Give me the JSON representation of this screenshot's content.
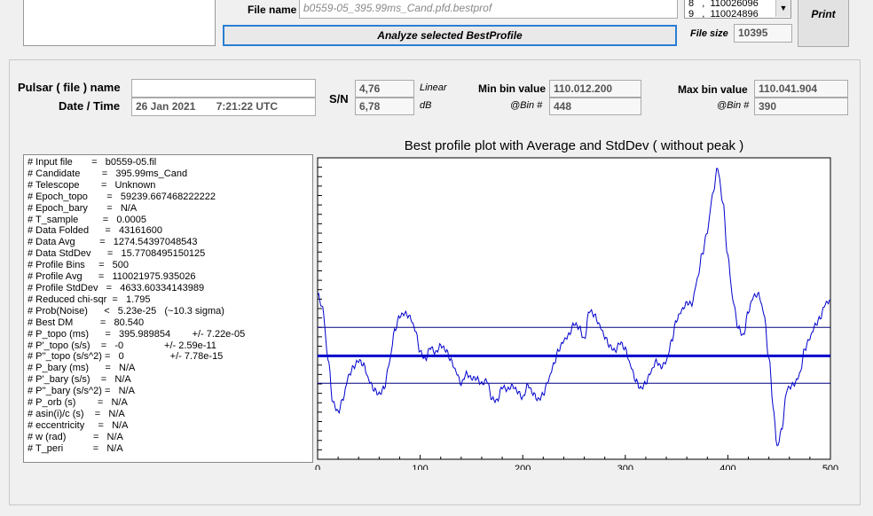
{
  "top": {
    "file_name_label": "File name",
    "file_name_value": "b0559-05_395.99ms_Cand.pfd.bestprof",
    "list_lines": [
      "8   ,  110026096",
      "9   ,  110024896"
    ],
    "analyze_button": "Analyze selected BestProfile",
    "file_size_label": "File size",
    "file_size_value": "10395",
    "print_button": "Print"
  },
  "header": {
    "pulsar_label": "Pulsar ( file ) name",
    "pulsar_value": "",
    "datetime_label": "Date / Time",
    "date_value": "26 Jan 2021",
    "time_value": "7:21:22  UTC",
    "sn_label": "S/N",
    "sn_linear_value": "4,76",
    "sn_linear_label": "Linear",
    "sn_db_value": "6,78",
    "sn_db_label": "dB",
    "min_bin_label": "Min bin value",
    "min_bin_value": "110.012.200",
    "min_at_label": "@Bin #",
    "min_at_value": "448",
    "max_bin_label": "Max bin value",
    "max_bin_value": "110.041.904",
    "max_at_label": "@Bin #",
    "max_at_value": "390"
  },
  "info_lines": [
    "# Input file       =   b0559-05.fil",
    "# Candidate        =   395.99ms_Cand",
    "# Telescope        =   Unknown",
    "# Epoch_topo       =   59239.667468222222",
    "# Epoch_bary       =   N/A",
    "# T_sample         =   0.0005",
    "# Data Folded      =   43161600",
    "# Data Avg         =   1274.54397048543",
    "# Data StdDev      =   15.7708495150125",
    "# Profile Bins     =   500",
    "# Profile Avg      =   110021975.935026",
    "# Profile StdDev   =   4633.60334143989",
    "# Reduced chi-sqr  =   1.795",
    "# Prob(Noise)      <   5.23e-25   (~10.3 sigma)",
    "# Best DM          =   80.540",
    "# P_topo (ms)      =   395.989854        +/- 7.22e-05",
    "# P'_topo (s/s)    =   -0               +/- 2.59e-11",
    "# P''_topo (s/s^2) =   0                 +/- 7.78e-15",
    "# P_bary (ms)      =   N/A",
    "# P'_bary (s/s)    =   N/A",
    "# P''_bary (s/s^2) =   N/A",
    "# P_orb (s)        =   N/A",
    "# asin(i)/c (s)    =   N/A",
    "# eccentricity     =   N/A",
    "# w (rad)          =   N/A",
    "# T_peri           =   N/A"
  ],
  "chart_data": {
    "type": "line",
    "title": "Best profile plot with  Average and StdDev ( without peak )",
    "xlabel": "",
    "ylabel": "",
    "xlim": [
      0,
      500
    ],
    "ylim": [
      110011000,
      110043000
    ],
    "xticks": [
      0,
      100,
      200,
      300,
      400,
      500
    ],
    "average": 110021976,
    "std_upper": 110024996,
    "std_lower": 110019076,
    "colors": {
      "profile": "#0000cc",
      "average": "#0000cc",
      "std": "#000080"
    },
    "profile": [
      [
        0,
        110028500
      ],
      [
        5,
        110027000
      ],
      [
        10,
        110021800
      ],
      [
        15,
        110017000
      ],
      [
        20,
        110016000
      ],
      [
        25,
        110017500
      ],
      [
        30,
        110019800
      ],
      [
        35,
        110020800
      ],
      [
        40,
        110021500
      ],
      [
        45,
        110021000
      ],
      [
        50,
        110019400
      ],
      [
        55,
        110018400
      ],
      [
        60,
        110017900
      ],
      [
        65,
        110018600
      ],
      [
        70,
        110021300
      ],
      [
        75,
        110024600
      ],
      [
        80,
        110026200
      ],
      [
        85,
        110026500
      ],
      [
        90,
        110026100
      ],
      [
        95,
        110024800
      ],
      [
        100,
        110022400
      ],
      [
        105,
        110021600
      ],
      [
        110,
        110022900
      ],
      [
        115,
        110022300
      ],
      [
        120,
        110023100
      ],
      [
        125,
        110022600
      ],
      [
        130,
        110021500
      ],
      [
        135,
        110020300
      ],
      [
        140,
        110019000
      ],
      [
        145,
        110020100
      ],
      [
        150,
        110019600
      ],
      [
        155,
        110019600
      ],
      [
        160,
        110019000
      ],
      [
        165,
        110019400
      ],
      [
        170,
        110017400
      ],
      [
        175,
        110017200
      ],
      [
        180,
        110018700
      ],
      [
        185,
        110018400
      ],
      [
        190,
        110018800
      ],
      [
        195,
        110018200
      ],
      [
        200,
        110017500
      ],
      [
        205,
        110018900
      ],
      [
        210,
        110018000
      ],
      [
        215,
        110017300
      ],
      [
        220,
        110017900
      ],
      [
        225,
        110019400
      ],
      [
        230,
        110021000
      ],
      [
        235,
        110022600
      ],
      [
        240,
        110023600
      ],
      [
        245,
        110024200
      ],
      [
        250,
        110025400
      ],
      [
        255,
        110025000
      ],
      [
        260,
        110023700
      ],
      [
        265,
        110026800
      ],
      [
        270,
        110026300
      ],
      [
        275,
        110025200
      ],
      [
        280,
        110024000
      ],
      [
        285,
        110023000
      ],
      [
        290,
        110022500
      ],
      [
        295,
        110023400
      ],
      [
        300,
        110022700
      ],
      [
        305,
        110021000
      ],
      [
        310,
        110019400
      ],
      [
        315,
        110018500
      ],
      [
        320,
        110019100
      ],
      [
        325,
        110020300
      ],
      [
        330,
        110021400
      ],
      [
        335,
        110020800
      ],
      [
        340,
        110021400
      ],
      [
        345,
        110023500
      ],
      [
        350,
        110025800
      ],
      [
        355,
        110026800
      ],
      [
        360,
        110027600
      ],
      [
        365,
        110027500
      ],
      [
        370,
        110030000
      ],
      [
        375,
        110032800
      ],
      [
        380,
        110035200
      ],
      [
        385,
        110039000
      ],
      [
        390,
        110041900
      ],
      [
        395,
        110038400
      ],
      [
        400,
        110032500
      ],
      [
        405,
        110027900
      ],
      [
        410,
        110025000
      ],
      [
        415,
        110024100
      ],
      [
        420,
        110026700
      ],
      [
        425,
        110028300
      ],
      [
        430,
        110028500
      ],
      [
        435,
        110026600
      ],
      [
        440,
        110021700
      ],
      [
        445,
        110015800
      ],
      [
        448,
        110012200
      ],
      [
        452,
        110014000
      ],
      [
        458,
        110018500
      ],
      [
        465,
        110019000
      ],
      [
        470,
        110020000
      ],
      [
        475,
        110022700
      ],
      [
        480,
        110023900
      ],
      [
        485,
        110025200
      ],
      [
        490,
        110026000
      ],
      [
        495,
        110027500
      ],
      [
        500,
        110027900
      ]
    ]
  }
}
